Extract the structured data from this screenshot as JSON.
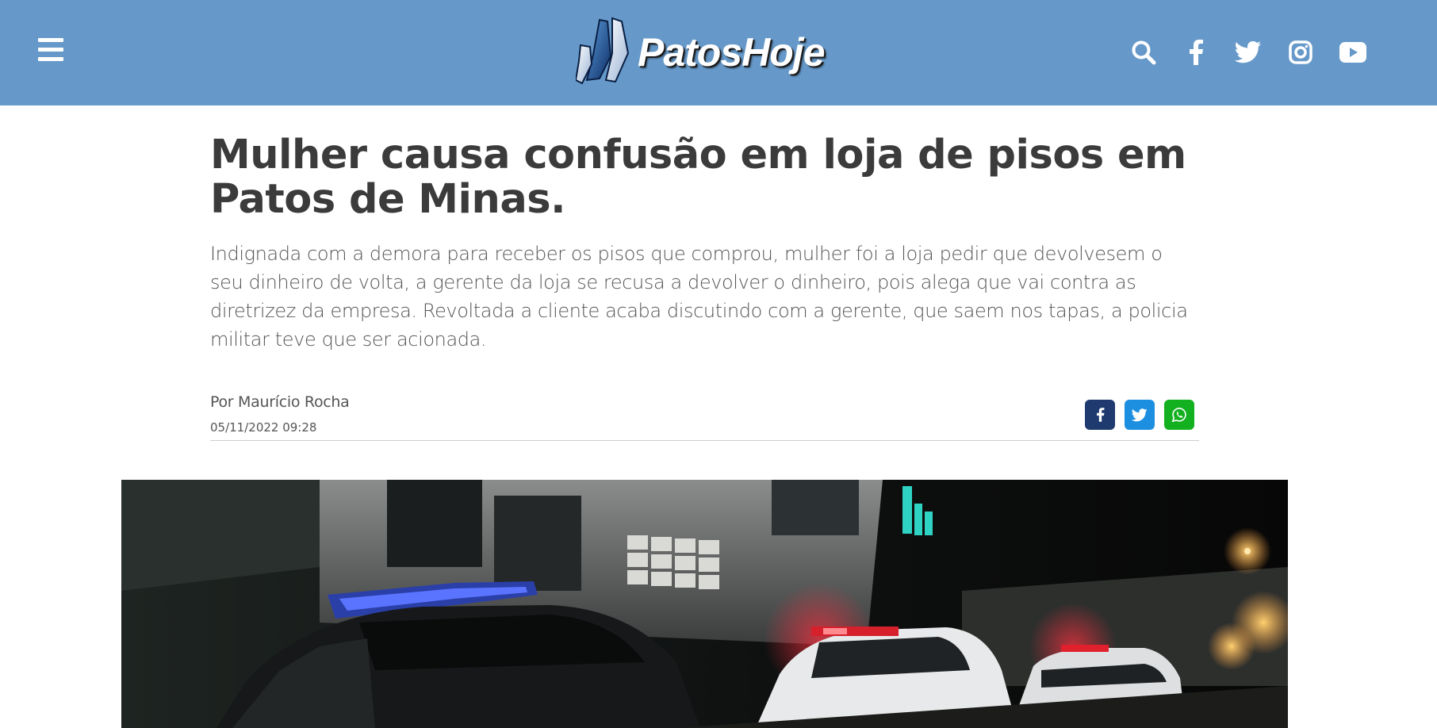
{
  "header": {
    "bg_color": "#6699c9",
    "menu_icon": "hamburger-menu-icon",
    "logo_text": "PatosHoje",
    "social_icons": [
      "search-icon",
      "facebook-icon",
      "twitter-icon",
      "instagram-icon",
      "youtube-icon"
    ]
  },
  "article": {
    "title": "Mulher causa confusão em loja de pisos em Patos de Minas.",
    "lede": "Indignada com a demora para receber os pisos que comprou, mulher foi a loja pedir que devolvesem o seu dinheiro de volta, a gerente da loja se recusa a devolver o dinheiro, pois alega que vai contra as diretrizez da empresa. Revoltada a cliente acaba discutindo com a gerente, que saem nos tapas, a policia militar teve que ser acionada.",
    "author": "Por Maurício Rocha",
    "date": "05/11/2022 09:28"
  },
  "share": {
    "buttons": [
      {
        "icon": "facebook-share-icon",
        "color": "#1f3a6e"
      },
      {
        "icon": "twitter-share-icon",
        "color": "#1d8fe0"
      },
      {
        "icon": "whatsapp-share-icon",
        "color": "#13b01f"
      }
    ]
  },
  "hero": {
    "icon": "police-cars-night-photo"
  }
}
